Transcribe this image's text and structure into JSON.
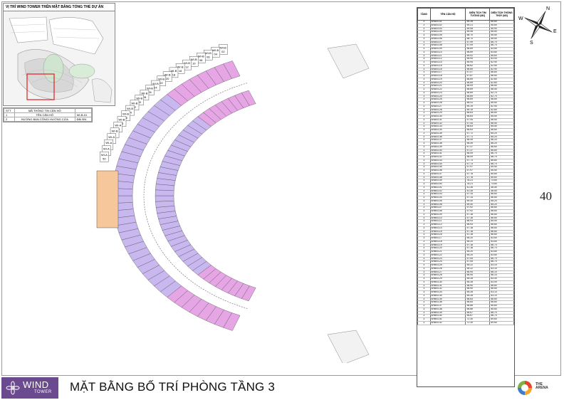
{
  "inset_title": "VỊ TRÍ WIND TOWER TRÊN MẶT BẰNG TỔNG THỂ DỰ ÁN",
  "legend": {
    "header": [
      "STT",
      "MÃ THÔNG TIN CĂN HỘ",
      ""
    ],
    "rows": [
      [
        "1",
        "TÊN CĂN HỘ",
        "WI-B-01"
      ],
      [
        "2",
        "HƯỚNG BAN CÔNG/ HƯỚNG CỬA",
        "ĐB/ ĐN"
      ]
    ]
  },
  "unit_labels": [
    {
      "code": "WI-B",
      "num": "02"
    },
    {
      "code": "WI-B",
      "num": "04"
    },
    {
      "code": "WI-B",
      "num": "06"
    },
    {
      "code": "WI-B",
      "num": "08"
    },
    {
      "code": "WI-B",
      "num": "10"
    },
    {
      "code": "WI-B",
      "num": "12"
    },
    {
      "code": "WI-B",
      "num": "16"
    },
    {
      "code": "WI-B",
      "num": "18"
    },
    {
      "code": "WI-B",
      "num": "20"
    },
    {
      "code": "WI-B",
      "num": "22"
    },
    {
      "code": "WI-B",
      "num": "24"
    },
    {
      "code": "WI-B",
      "num": "26"
    },
    {
      "code": "WI-B",
      "num": "28"
    },
    {
      "code": "WI-B",
      "num": "30"
    },
    {
      "code": "WI-B",
      "num": "32"
    },
    {
      "code": "WI-B",
      "num": "34"
    },
    {
      "code": "WI-B",
      "num": "36"
    },
    {
      "code": "WI-B",
      "num": "38"
    },
    {
      "code": "WI-A",
      "num": "40"
    },
    {
      "code": "WI-B",
      "num": "42"
    },
    {
      "code": "WI-A",
      "num": "44"
    },
    {
      "code": "WI-A",
      "num": "46"
    },
    {
      "code": "WI-A",
      "num": "48"
    },
    {
      "code": "WI-A",
      "num": "50"
    }
  ],
  "table": {
    "headers": [
      "TẦNG",
      "TÊN CĂN HỘ",
      "DIỆN TÍCH TIM TƯỜNG (M2)",
      "DIỆN TÍCH THÔNG THỦY (M2)"
    ],
    "rows": [
      [
        "3",
        "WIA03-01",
        "59.28",
        "55.60"
      ],
      [
        "3",
        "WIA03-02",
        "59.21",
        "55.60"
      ],
      [
        "3",
        "WIA03-03",
        "59.08",
        "55.90"
      ],
      [
        "3",
        "WIA03-04",
        "59.06",
        "55.50"
      ],
      [
        "3",
        "WIA03-05",
        "58.70",
        "55.50"
      ],
      [
        "3",
        "WIA03-06",
        "58.70",
        "55.50"
      ],
      [
        "3",
        "WIA03-07",
        "57.99",
        "56.70"
      ],
      [
        "3",
        "WIA03-08",
        "57.09",
        "56.70"
      ],
      [
        "3",
        "WIA03-09",
        "56.69",
        "53.60"
      ],
      [
        "3",
        "WIA03-10",
        "56.69",
        "53.60"
      ],
      [
        "3",
        "WIA03-11",
        "59.02",
        "55.60"
      ],
      [
        "3",
        "WIA03-12",
        "55.94",
        "53.00"
      ],
      [
        "3",
        "WIA03-14",
        "55.94",
        "52.90"
      ],
      [
        "3",
        "WIA03-15",
        "56.62",
        "52.50"
      ],
      [
        "3",
        "WIA03-16",
        "56.69",
        "52.90"
      ],
      [
        "3",
        "WIA03-17",
        "57.07",
        "56.60"
      ],
      [
        "3",
        "WIA03-18",
        "57.87",
        "56.60"
      ],
      [
        "3",
        "WIA03-19",
        "56.69",
        "52.60"
      ],
      [
        "3",
        "WIA03-20",
        "56.69",
        "52.60"
      ],
      [
        "3",
        "WIA03-21",
        "56.09",
        "56.50"
      ],
      [
        "3",
        "WIA03-22",
        "56.69",
        "56.50"
      ],
      [
        "3",
        "WIA03-23",
        "56.69",
        "52.70"
      ],
      [
        "3",
        "WIA03-24",
        "56.69",
        "52.70"
      ],
      [
        "3",
        "WIA03-25",
        "56.69",
        "56.60"
      ],
      [
        "3",
        "WIA03-26",
        "56.41",
        "55.50"
      ],
      [
        "3",
        "WIA03-27",
        "59.19",
        "52.90"
      ],
      [
        "3",
        "WIA03-28",
        "59.19",
        "52.60"
      ],
      [
        "3",
        "WIA03-29",
        "56.63",
        "56.60"
      ],
      [
        "3",
        "WIA03-30",
        "56.63",
        "55.50"
      ],
      [
        "3",
        "WIA03-31",
        "57.44",
        "56.50"
      ],
      [
        "3",
        "WIA03-32",
        "57.44",
        "56.50"
      ],
      [
        "3",
        "WIA03-33",
        "56.63",
        "55.50"
      ],
      [
        "3",
        "WIA03-34",
        "56.63",
        "56.60"
      ],
      [
        "3",
        "WIA03-35",
        "57.72",
        "55.20"
      ],
      [
        "3",
        "WIA03-36",
        "57.71",
        "55.20"
      ],
      [
        "3",
        "WIA03-37",
        "56.49",
        "56.20"
      ],
      [
        "3",
        "WIA03-38",
        "56.49",
        "56.20"
      ],
      [
        "3",
        "WIA03-39",
        "57.37",
        "56.60"
      ],
      [
        "3",
        "WIA03-40",
        "57.37",
        "56.60"
      ],
      [
        "3",
        "WIA03-41",
        "56.09",
        "56.70"
      ],
      [
        "3",
        "WIA03-42",
        "56.09",
        "56.70"
      ],
      [
        "3",
        "WIA03-43",
        "57.73",
        "56.60"
      ],
      [
        "3",
        "WIA03-44",
        "57.73",
        "56.70"
      ],
      [
        "3",
        "WIA03-45",
        "57.97",
        "55.50"
      ],
      [
        "3",
        "WIA03-46",
        "57.97",
        "55.50"
      ],
      [
        "3",
        "WIA03-47",
        "57.78",
        "55.60"
      ],
      [
        "3",
        "WIA03-48",
        "57.78",
        "55.60"
      ],
      [
        "3",
        "WIA03-49",
        "78.21",
        "73.60"
      ],
      [
        "3",
        "WIA03-50",
        "78.21",
        "73.60"
      ],
      [
        "3",
        "WIB03-01",
        "41.35",
        "36.50"
      ],
      [
        "3",
        "WIB03-02",
        "41.35",
        "36.50"
      ],
      [
        "3",
        "WIB03-03",
        "57.14",
        "56.60"
      ],
      [
        "3",
        "WIB03-04",
        "57.14",
        "56.60"
      ],
      [
        "3",
        "WIB03-05",
        "59.40",
        "55.20"
      ],
      [
        "3",
        "WIB03-06",
        "59.40",
        "55.20"
      ],
      [
        "3",
        "WIB03-07",
        "57.92",
        "56.60"
      ],
      [
        "3",
        "WIB03-08",
        "57.92",
        "56.60"
      ],
      [
        "3",
        "WIB03-09",
        "57.16",
        "56.60"
      ],
      [
        "3",
        "WIB03-10",
        "57.16",
        "56.60"
      ],
      [
        "3",
        "WIB03-11",
        "56.93",
        "55.90"
      ],
      [
        "3",
        "WIB03-12",
        "56.93",
        "56.60"
      ],
      [
        "3",
        "WIB03-14",
        "57.18",
        "56.60"
      ],
      [
        "3",
        "WIB03-15",
        "57.18",
        "56.60"
      ],
      [
        "3",
        "WIB03-16",
        "57.18",
        "56.60"
      ],
      [
        "3",
        "WIB03-17",
        "55.20",
        "53.60"
      ],
      [
        "3",
        "WIB03-18",
        "55.20",
        "53.60"
      ],
      [
        "3",
        "WIB03-19",
        "57.18",
        "56.70"
      ],
      [
        "3",
        "WIB03-20",
        "57.18",
        "56.70"
      ],
      [
        "3",
        "WIB03-21",
        "55.20",
        "53.60"
      ],
      [
        "3",
        "WIB03-22",
        "55.20",
        "53.60"
      ],
      [
        "3",
        "WIB03-23",
        "57.05",
        "56.70"
      ],
      [
        "3",
        "WIB03-24",
        "57.05",
        "56.70"
      ],
      [
        "3",
        "WIB03-25",
        "55.22",
        "53.10"
      ],
      [
        "3",
        "WIB03-26",
        "55.22",
        "53.10"
      ],
      [
        "3",
        "WIB03-27",
        "56.94",
        "56.10"
      ],
      [
        "3",
        "WIB03-28",
        "56.94",
        "56.10"
      ],
      [
        "3",
        "WIB03-29",
        "55.28",
        "53.00"
      ],
      [
        "3",
        "WIB03-30",
        "55.28",
        "53.00"
      ],
      [
        "3",
        "WIB03-31",
        "56.90",
        "56.60"
      ],
      [
        "3",
        "WIB03-32",
        "56.90",
        "56.60"
      ],
      [
        "3",
        "WIB03-33",
        "55.28",
        "53.10"
      ],
      [
        "3",
        "WIB03-34",
        "55.28",
        "53.10"
      ],
      [
        "3",
        "WIB03-35",
        "56.83",
        "56.60"
      ],
      [
        "3",
        "WIB03-36",
        "56.83",
        "56.60"
      ],
      [
        "3",
        "WIB03-37",
        "56.86",
        "55.60"
      ],
      [
        "3",
        "WIB03-38",
        "56.86",
        "55.60"
      ],
      [
        "3",
        "WIB03-39",
        "56.67",
        "56.70"
      ],
      [
        "3",
        "WIB03-40",
        "56.67",
        "56.70"
      ],
      [
        "3",
        "WIB03-41",
        "72.30",
        "69.60"
      ],
      [
        "3",
        "WIB03-42",
        "72.30",
        "69.60"
      ]
    ]
  },
  "page_number": "40",
  "compass": {
    "n": "N",
    "s": "S",
    "e": "E",
    "w": "W"
  },
  "logo": {
    "name": "WIND",
    "sub": "TOWER"
  },
  "title": "MẶT BẰNG BỐ TRÍ PHÒNG TẦNG 3",
  "partner": {
    "line1": "THE",
    "line2": "ARENA"
  },
  "colors": {
    "unit_purple": "#c9b8f0",
    "unit_pink": "#e6a6e6",
    "core_orange": "#f6c79a",
    "brand": "#6b4a8f",
    "red_box": "#e02020"
  }
}
